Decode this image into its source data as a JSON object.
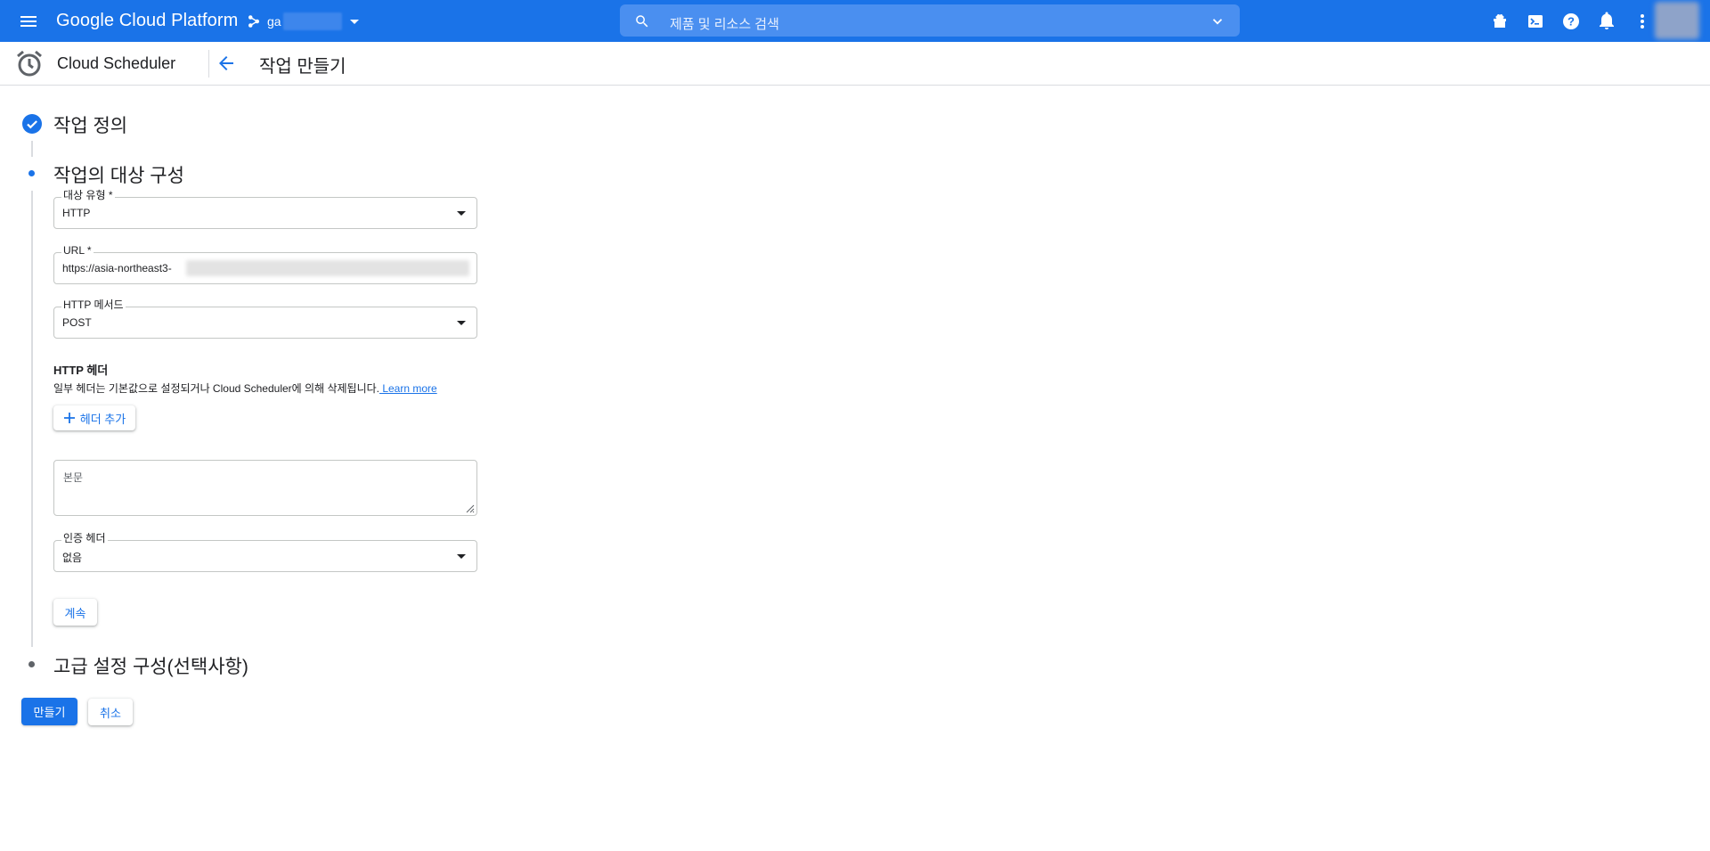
{
  "topbar": {
    "brand": "Google Cloud Platform",
    "project_prefix": "ga",
    "search_placeholder": "제품 및 리소스 검색"
  },
  "subheader": {
    "product_name": "Cloud Scheduler",
    "page_title": "작업 만들기"
  },
  "steps": {
    "step1_title": "작업 정의",
    "step2_title": "작업의 대상 구성",
    "step3_title": "고급 설정 구성(선택사항)"
  },
  "form": {
    "target_type": {
      "label": "대상 유형 *",
      "value": "HTTP"
    },
    "url": {
      "label": "URL *",
      "value": "https://asia-northeast3-"
    },
    "http_method": {
      "label": "HTTP 메서드",
      "value": "POST"
    },
    "headers": {
      "title": "HTTP 헤더",
      "description": "일부 헤더는 기본값으로 설정되거나 Cloud Scheduler에 의해 삭제됩니다.",
      "learn_more": " Learn more",
      "add_button": "헤더 추가"
    },
    "body_placeholder": "본문",
    "auth_header": {
      "label": "인증 헤더",
      "value": "없음"
    },
    "continue_button": "계속"
  },
  "actions": {
    "create": "만들기",
    "cancel": "취소"
  },
  "colors": {
    "primary": "#1a73e8",
    "step_inactive": "#5f6368"
  }
}
